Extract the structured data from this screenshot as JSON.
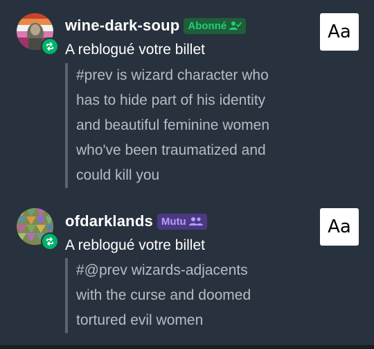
{
  "notifications": [
    {
      "username": "wine-dark-soup",
      "badge_label": "Abonné",
      "badge_icon": "person-check-icon",
      "action": "A reblogué votre billet",
      "quote_lines": [
        "#prev is wizard character who",
        "has to hide part of his identity",
        "and beautiful feminine women",
        "who've been traumatized and",
        "could kill you"
      ],
      "aa_label": "Aa"
    },
    {
      "username": "ofdarklands",
      "badge_label": "Mutu",
      "badge_icon": "people-icon",
      "action": "A reblogué votre billet",
      "quote_lines": [
        "#@prev wizards-adjacents",
        "with the curse and doomed",
        "tortured evil women"
      ],
      "aa_label": "Aa"
    }
  ],
  "colors": {
    "background": "#28323e",
    "follow_badge_bg": "#1e5e3a",
    "follow_badge_text": "#1fd07a",
    "mutual_badge_bg": "#4b3a82",
    "mutual_badge_text": "#b79cff",
    "reblog_green": "#00b36b"
  }
}
